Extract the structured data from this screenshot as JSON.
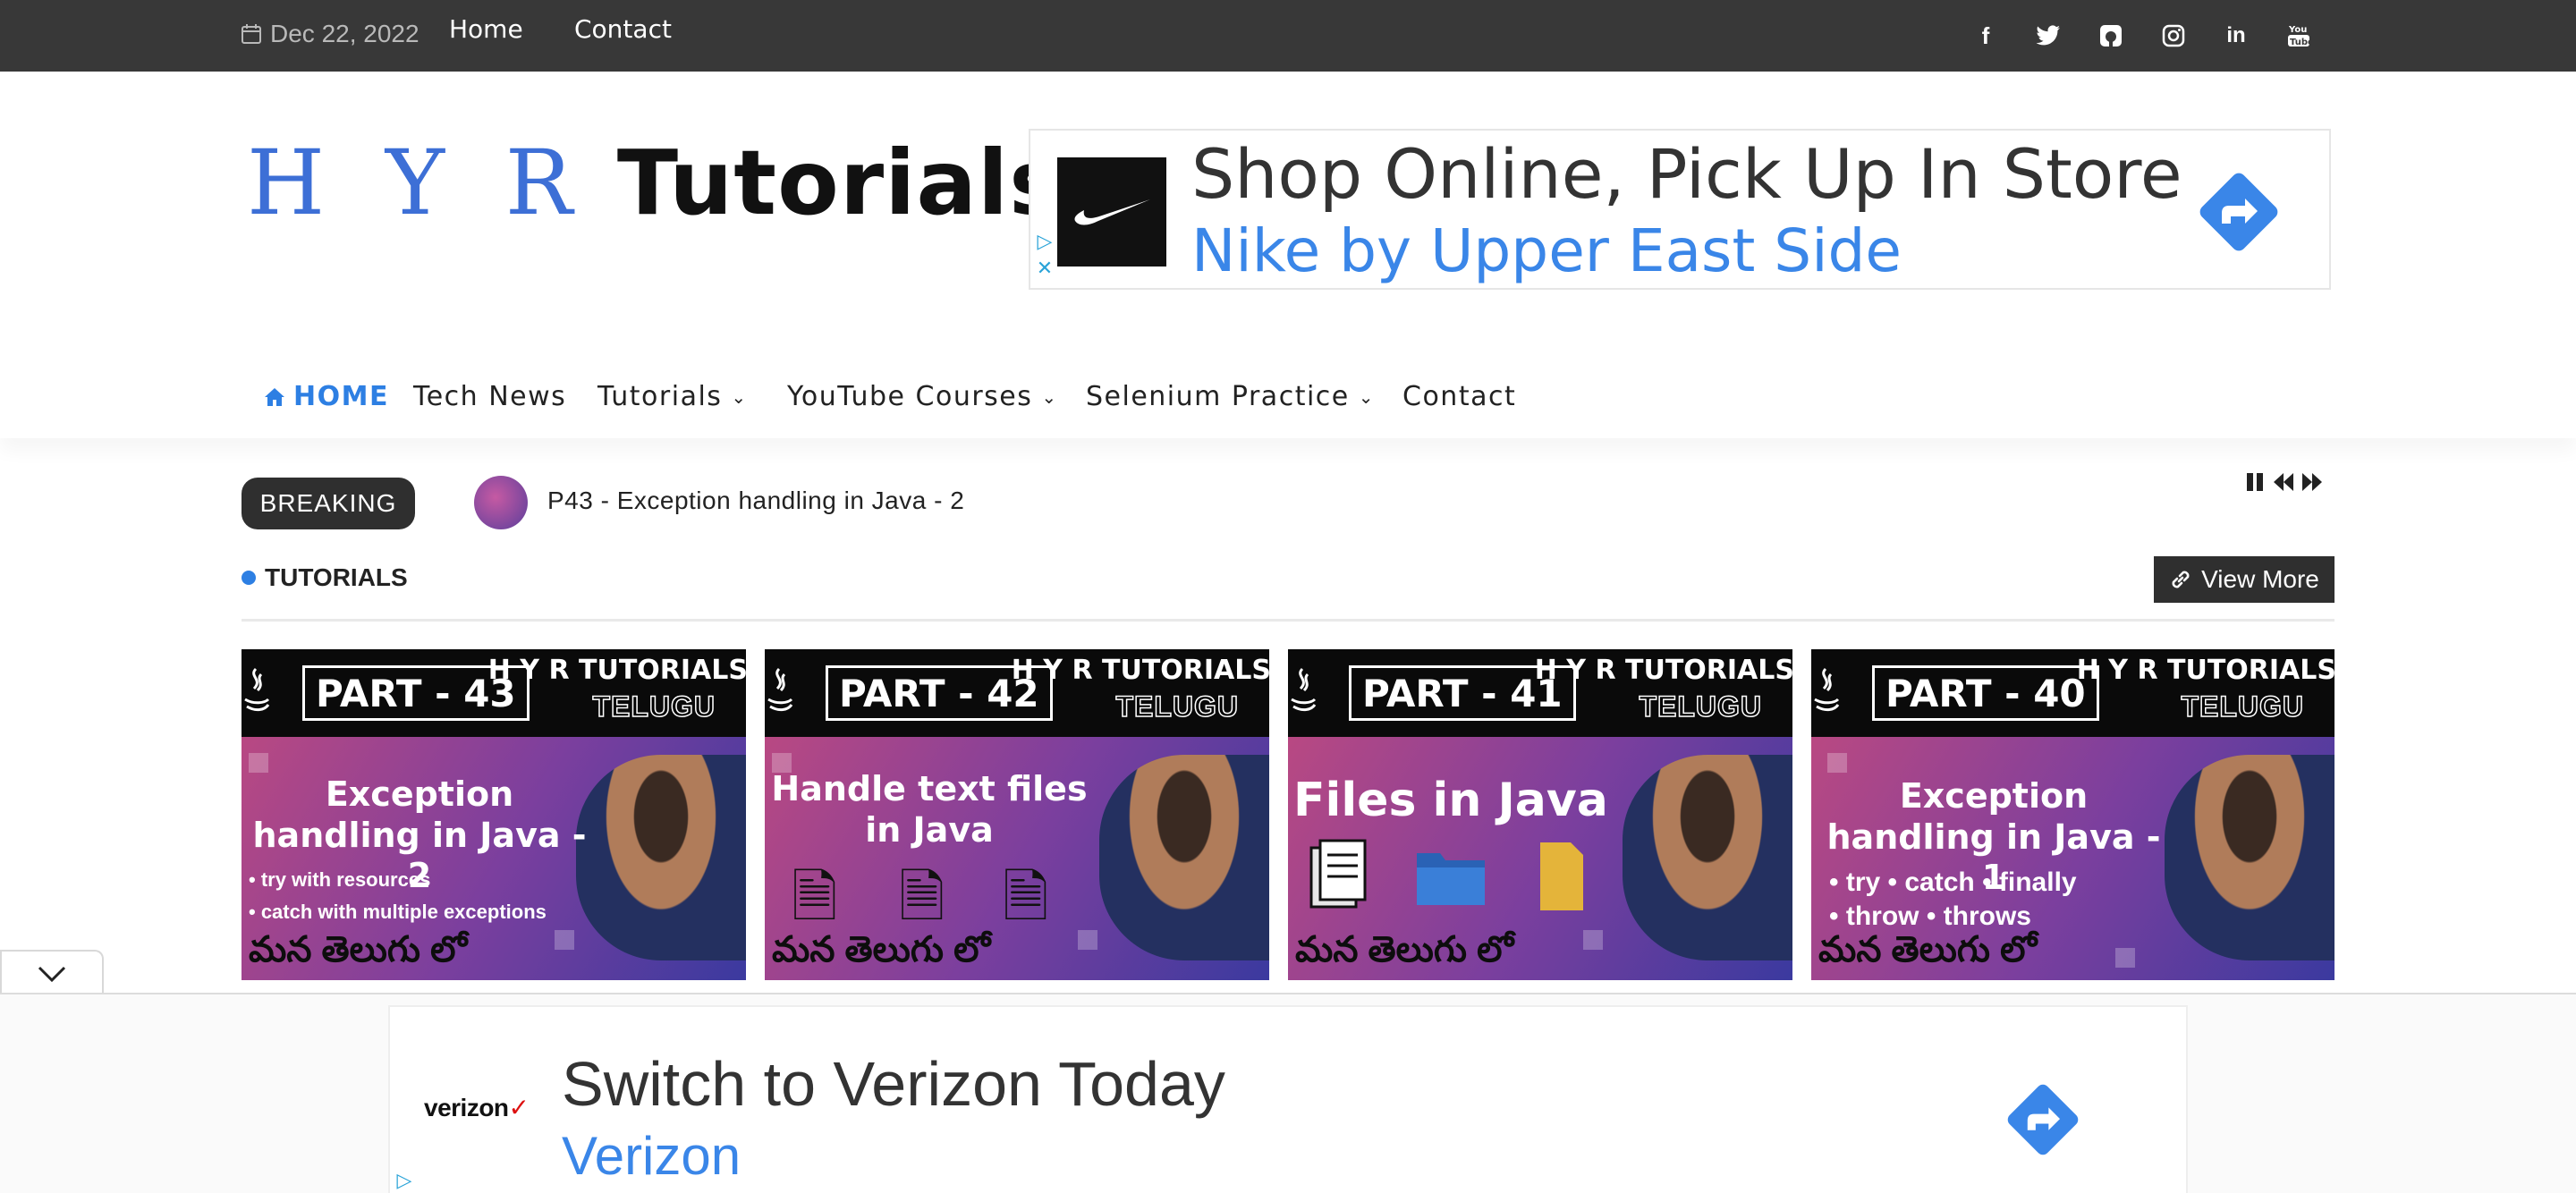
{
  "topbar": {
    "date": "Dec 22, 2022",
    "links": [
      "Home",
      "Contact"
    ],
    "social": [
      "facebook-icon",
      "twitter-icon",
      "github-icon",
      "instagram-icon",
      "linkedin-icon",
      "youtube-icon"
    ]
  },
  "logo": {
    "part1": "H Y R",
    "part2": "Tutorials"
  },
  "ad_top": {
    "headline": "Shop Online, Pick Up In Store",
    "advertiser": "Nike by Upper East Side"
  },
  "nav": {
    "items": [
      {
        "label": "HOME",
        "icon": "home-icon",
        "active": true
      },
      {
        "label": "Tech News"
      },
      {
        "label": "Tutorials",
        "dropdown": true
      },
      {
        "label": "YouTube Courses",
        "dropdown": true
      },
      {
        "label": "Selenium Practice",
        "dropdown": true
      },
      {
        "label": "Contact"
      }
    ]
  },
  "breaking": {
    "label": "BREAKING",
    "text": "P43 - Exception handling in Java - 2"
  },
  "section": {
    "title": "TUTORIALS",
    "view_more": "View More"
  },
  "cards": [
    {
      "part": "PART - 43",
      "brand1": "H Y R TUTORIALS",
      "brand2": "TELUGU",
      "title": "Exception handling in Java - 2",
      "bullets": [
        "• try with resources",
        "• catch with multiple exceptions"
      ],
      "telugu": "మన తెలుగు లో"
    },
    {
      "part": "PART - 42",
      "brand1": "H Y R TUTORIALS",
      "brand2": "TELUGU",
      "title": "Handle text files in Java",
      "telugu": "మన తెలుగు లో"
    },
    {
      "part": "PART - 41",
      "brand1": "H Y R TUTORIALS",
      "brand2": "TELUGU",
      "title": "Files in Java",
      "telugu": "మన తెలుగు లో"
    },
    {
      "part": "PART - 40",
      "brand1": "H Y R TUTORIALS",
      "brand2": "TELUGU",
      "title": "Exception handling in Java - 1",
      "bullets": [
        "• try   • catch   • finally",
        "• throw  • throws"
      ],
      "telugu": "మన తెలుగు లో"
    }
  ],
  "ad_bottom": {
    "brand": "verizon",
    "brand_mark": "✓",
    "headline": "Switch to Verizon Today",
    "advertiser": "Verizon"
  },
  "colors": {
    "accent": "#2d7fe3",
    "topbar": "#383838",
    "ad_link": "#3a86e8"
  }
}
